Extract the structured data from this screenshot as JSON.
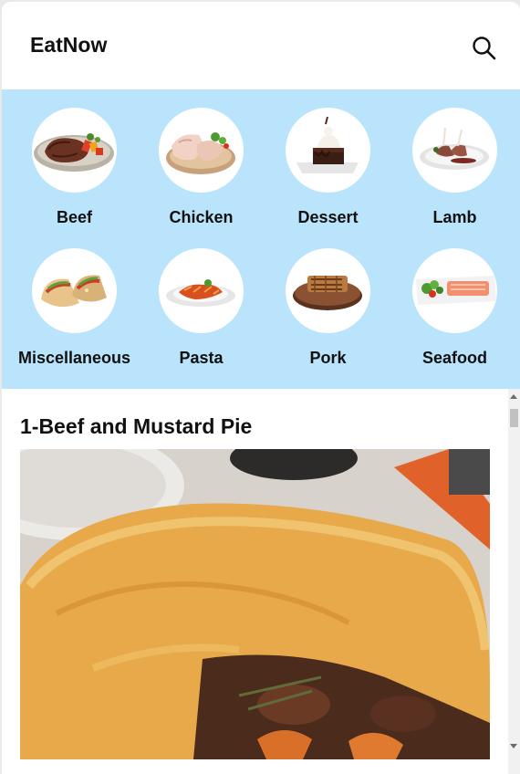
{
  "header": {
    "title": "EatNow",
    "search_icon": "search-icon"
  },
  "categories": [
    {
      "label": "Beef",
      "icon": "beef-dish"
    },
    {
      "label": "Chicken",
      "icon": "chicken-dish"
    },
    {
      "label": "Dessert",
      "icon": "dessert-dish"
    },
    {
      "label": "Lamb",
      "icon": "lamb-dish"
    },
    {
      "label": "Miscellaneous",
      "icon": "tacos-dish"
    },
    {
      "label": "Pasta",
      "icon": "pasta-dish"
    },
    {
      "label": "Pork",
      "icon": "pork-dish"
    },
    {
      "label": "Seafood",
      "icon": "seafood-dish"
    }
  ],
  "recipes": [
    {
      "title": "1-Beef and Mustard Pie"
    }
  ],
  "colors": {
    "category_band": "#b9e4fb",
    "background": "#ffffff",
    "text": "#111111"
  }
}
